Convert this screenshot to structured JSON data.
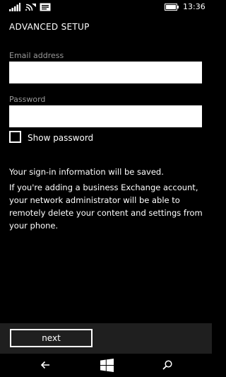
{
  "status_bar": {
    "time": "13:36",
    "icons": [
      "signal-icon",
      "wifi-icon",
      "message-icon",
      "battery-icon"
    ]
  },
  "page": {
    "title": "ADVANCED SETUP"
  },
  "form": {
    "email_label": "Email address",
    "email_value": "",
    "password_label": "Password",
    "password_value": "",
    "show_password_label": "Show password",
    "show_password_checked": false
  },
  "info": {
    "saved_text": "Your sign-in information will be saved.",
    "exchange_text": "If you're adding a business Exchange account, your network administrator will be able to remotely delete your content and settings from your phone."
  },
  "app_bar": {
    "next_label": "next"
  },
  "nav_bar": {
    "icons": [
      "back-arrow-icon",
      "windows-logo-icon",
      "search-icon"
    ]
  },
  "colors": {
    "background": "#000000",
    "text": "#ffffff",
    "label": "#9a9a9a",
    "app_bar": "#1f1f1f"
  }
}
